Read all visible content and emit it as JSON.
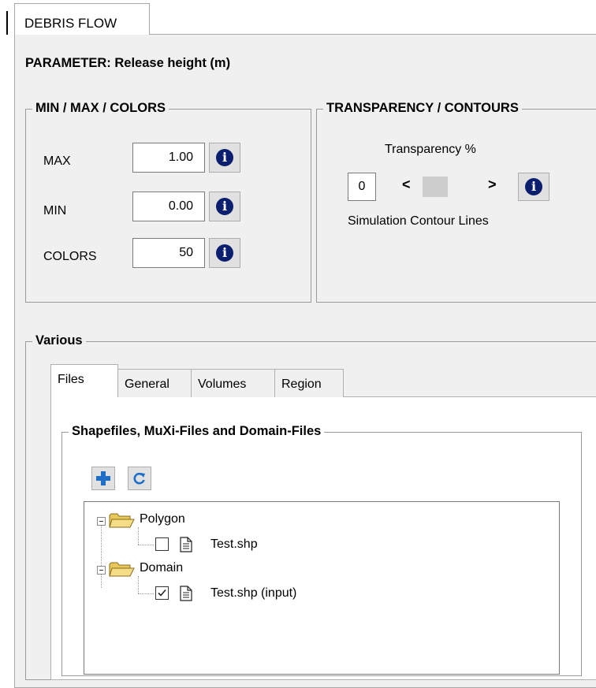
{
  "window": {
    "tab_label": "DEBRIS FLOW"
  },
  "parameter": {
    "title": "PARAMETER: Release height (m)"
  },
  "minmax_group": {
    "title": "MIN / MAX / COLORS",
    "max_label": "MAX",
    "max_value": "1.00",
    "min_label": "MIN",
    "min_value": "0.00",
    "colors_label": "COLORS",
    "colors_value": "50",
    "info_icon": "i"
  },
  "transparency_group": {
    "title": "TRANSPARENCY / CONTOURS",
    "transparency_label": "Transparency %",
    "transparency_value": "0",
    "scroll_left": "<",
    "scroll_right": ">",
    "contour_label": "Simulation Contour Lines",
    "info_icon": "i"
  },
  "various": {
    "title": "Various",
    "tabs": [
      {
        "label": "Files",
        "active": true
      },
      {
        "label": "General",
        "active": false
      },
      {
        "label": "Volumes",
        "active": false
      },
      {
        "label": "Region",
        "active": false
      }
    ],
    "files": {
      "group_title": "Shapefiles, MuXi-Files and Domain-Files",
      "add_icon": "plus-icon",
      "refresh_icon": "refresh-icon",
      "tree": [
        {
          "label": "Polygon",
          "children": [
            {
              "label": "Test.shp",
              "checked": false
            }
          ]
        },
        {
          "label": "Domain",
          "children": [
            {
              "label": "Test.shp (input)",
              "checked": true
            }
          ]
        }
      ]
    }
  },
  "colors": {
    "panel_bg": "#f0f0f0",
    "info_icon_bg": "#0c1f6e",
    "plus_blue": "#1f6fc9",
    "folder_yellow": "#e8c85a"
  }
}
